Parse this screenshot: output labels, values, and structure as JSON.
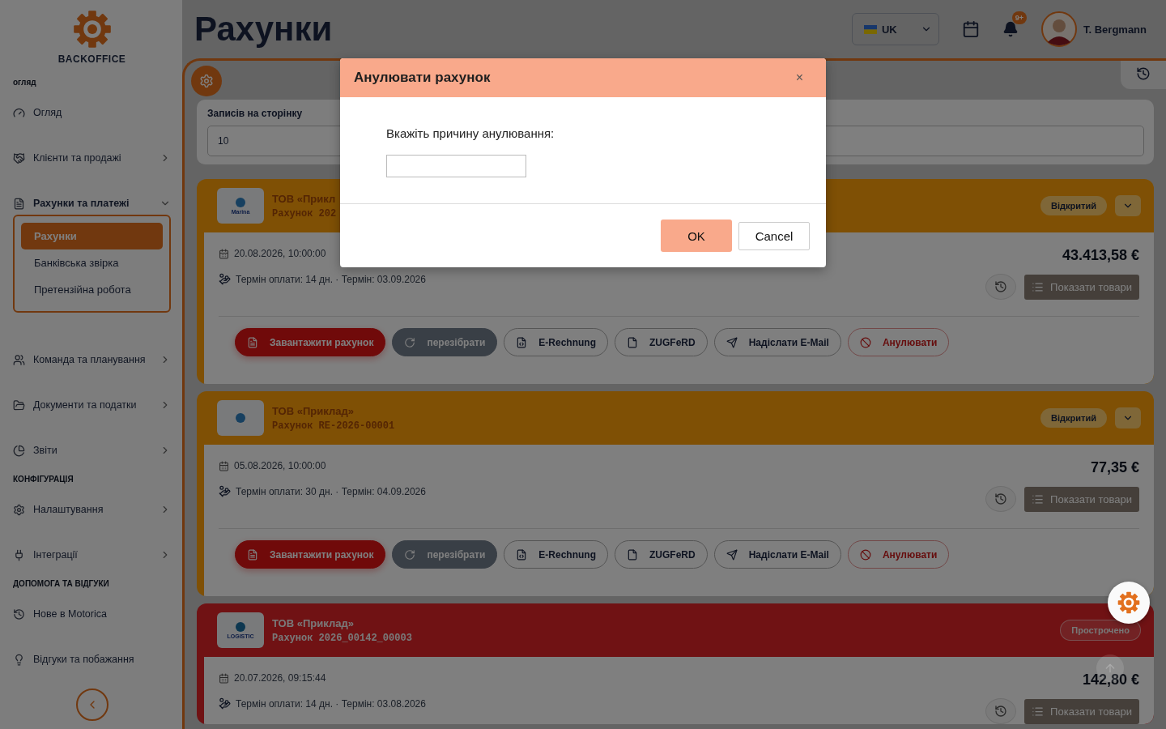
{
  "sidebar": {
    "brand": "BACKOFFICE",
    "sections": [
      {
        "title": "огляд",
        "items": [
          {
            "label": "Огляд",
            "kind": "link"
          },
          {
            "label": "Клієнти та продажі",
            "kind": "group",
            "expanded": false
          },
          {
            "label": "Рахунки та платежі",
            "kind": "group",
            "expanded": true,
            "children": [
              {
                "label": "Рахунки",
                "selected": true
              },
              {
                "label": "Банківська звірка",
                "selected": false
              },
              {
                "label": "Претензійна робота",
                "selected": false
              }
            ]
          },
          {
            "label": "Команда та планування",
            "kind": "group",
            "expanded": false
          },
          {
            "label": "Документи та податки",
            "kind": "group",
            "expanded": false
          },
          {
            "label": "Звіти",
            "kind": "group",
            "expanded": false
          }
        ]
      },
      {
        "title": "КОНФІГУРАЦІЯ",
        "items": [
          {
            "label": "Налаштування",
            "kind": "group",
            "expanded": false
          },
          {
            "label": "Інтеграції",
            "kind": "group",
            "expanded": false
          }
        ]
      },
      {
        "title": "ДОПОМОГА ТА ВІДГУКИ",
        "items": [
          {
            "label": "Нове в Motorica",
            "kind": "link"
          },
          {
            "label": "Відгуки та побажання",
            "kind": "link"
          }
        ]
      }
    ]
  },
  "header": {
    "title": "Рахунки",
    "language": "UK",
    "notifications": "9+",
    "user": "T. Bergmann"
  },
  "filters": {
    "label": "Записів на сторінку",
    "value": "10"
  },
  "invoices": [
    {
      "color": "#7f5005",
      "logo_text": "Marina",
      "company": "ТОВ «Прикл",
      "number": "Рахунок 202",
      "status": "Відкритий",
      "date": "20.08.2026, 10:00:00",
      "terms": "Термін оплати: 14 дн. · Термін: 03.09.2026",
      "amount": "43.413,58 €",
      "items_button": "Показати товари",
      "actions": [
        {
          "label": "Завантажити рахунок",
          "kind": "primary"
        },
        {
          "label": "перезібрати",
          "kind": "dark"
        },
        {
          "label": "E-Rechnung",
          "kind": "outline"
        },
        {
          "label": "ZUGFeRD",
          "kind": "outline"
        },
        {
          "label": "Надіслати E-Mail",
          "kind": "outline"
        },
        {
          "label": "Анулювати",
          "kind": "danger"
        }
      ]
    },
    {
      "color": "#7f5005",
      "company": "ТОВ «Приклад»",
      "number": "Рахунок RE-2026-00001",
      "status": "Відкритий",
      "date": "05.08.2026, 10:00:00",
      "terms": "Термін оплати: 30 дн. · Термін: 04.09.2026",
      "amount": "77,35 €",
      "items_button": "Показати товари",
      "actions": [
        {
          "label": "Завантажити рахунок",
          "kind": "primary"
        },
        {
          "label": "перезібрати",
          "kind": "dark"
        },
        {
          "label": "E-Rechnung",
          "kind": "outline"
        },
        {
          "label": "ZUGFeRD",
          "kind": "outline"
        },
        {
          "label": "Надіслати E-Mail",
          "kind": "outline"
        },
        {
          "label": "Анулювати",
          "kind": "danger"
        }
      ]
    },
    {
      "color": "#701214",
      "logo_text": "LOGISTIC",
      "company": "ТОВ «Приклад»",
      "number": "Рахунок 2026_00142_00003",
      "status": "Прострочено",
      "date": "20.07.2026, 09:15:44",
      "terms": "Термін оплати: 14 дн. · Термін: 03.08.2026",
      "amount": "142,80 €",
      "items_button": "Показати товари"
    }
  ],
  "dialog": {
    "title": "Анулювати рахунок",
    "close": "×",
    "prompt": "Вкажіть причину анулювання:",
    "ok": "OK",
    "cancel": "Cancel"
  }
}
